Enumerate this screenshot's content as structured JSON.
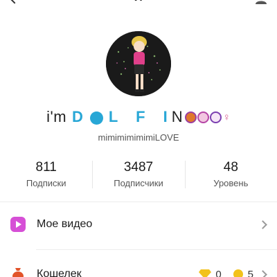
{
  "header": {
    "title": "Я"
  },
  "profile": {
    "name_plain": "i'm",
    "name_styled": "L F I",
    "name_n": "N",
    "username": "mimimimimimiLOVE"
  },
  "stats": [
    {
      "value": "811",
      "label": "Подписки"
    },
    {
      "value": "3487",
      "label": "Подписчики"
    },
    {
      "value": "48",
      "label": "Уровень"
    }
  ],
  "menu": {
    "video_label": "Мое видео",
    "wallet_label": "Кошелек",
    "diamonds": "0",
    "coins": "5"
  },
  "colors": {
    "accent_blue": "#28a7d6",
    "video_icon": "#d64fd6",
    "wallet_icon": "#e2542a"
  }
}
